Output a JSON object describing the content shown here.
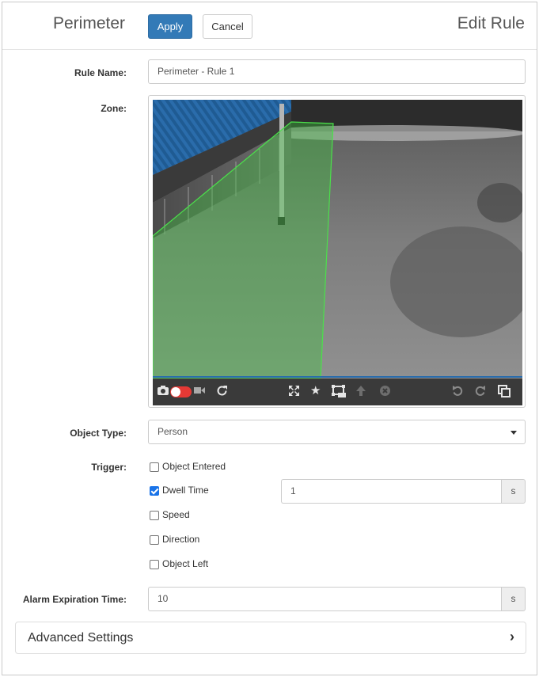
{
  "header": {
    "title": "Perimeter",
    "apply_label": "Apply",
    "cancel_label": "Cancel",
    "right_title": "Edit Rule"
  },
  "form": {
    "rule_name_label": "Rule Name:",
    "rule_name_value": "Perimeter - Rule 1",
    "zone_label": "Zone:",
    "object_type_label": "Object Type:",
    "object_type_value": "Person",
    "trigger_label": "Trigger:",
    "triggers": [
      {
        "label": "Object Entered",
        "checked": false
      },
      {
        "label": "Dwell Time",
        "checked": true
      },
      {
        "label": "Speed",
        "checked": false
      },
      {
        "label": "Direction",
        "checked": false
      },
      {
        "label": "Object Left",
        "checked": false
      }
    ],
    "dwell_time_value": "1",
    "dwell_time_unit": "s",
    "alarm_label": "Alarm Expiration Time:",
    "alarm_value": "10",
    "alarm_unit": "s",
    "advanced_label": "Advanced Settings"
  },
  "toolbar_icons": [
    "camera-icon",
    "record-toggle",
    "video-icon",
    "refresh-icon",
    "fullscreen-icon",
    "star-icon",
    "zone-select-icon",
    "arrow-up-icon",
    "delete-icon",
    "undo-icon",
    "redo-icon",
    "copy-icon"
  ],
  "colors": {
    "primary": "#337ab7",
    "zone_overlay": "#3cc83c",
    "toggle_red": "#e53935",
    "checkbox": "#1a73e8"
  }
}
